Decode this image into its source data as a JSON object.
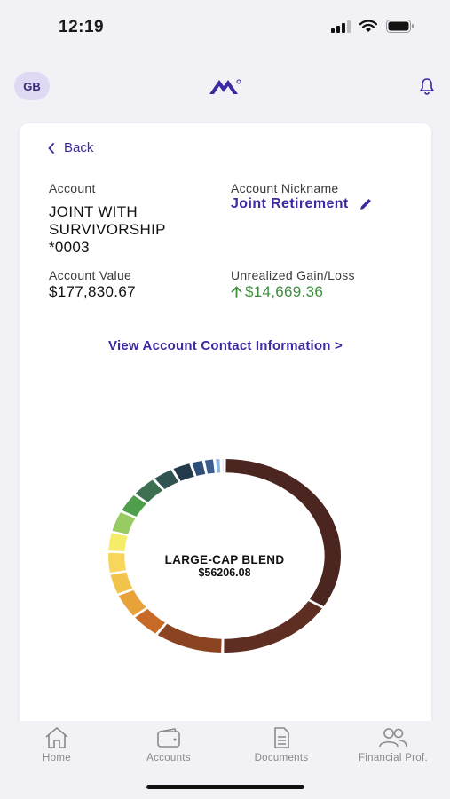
{
  "status": {
    "time": "12:19"
  },
  "header": {
    "avatar_initials": "GB",
    "logo_icon": "mountain-logo",
    "bell_icon": "bell-icon"
  },
  "card": {
    "back_label": "Back",
    "account_label": "Account",
    "account_name_lines": [
      "JOINT WITH",
      "SURVIVORSHIP",
      "*0003"
    ],
    "nickname_label": "Account Nickname",
    "nickname_value": "Joint Retirement",
    "value_label": "Account Value",
    "value_amount": "$177,830.67",
    "gain_label": "Unrealized Gain/Loss",
    "gain_amount": "$14,669.36",
    "view_contact": "View Account Contact Information >",
    "accent_color": "#3b2aa0",
    "gain_color": "#3e8e3e"
  },
  "chart_data": {
    "type": "pie",
    "style": "donut",
    "selected": {
      "label": "LARGE-CAP BLEND",
      "value": "$56206.08"
    },
    "values": [
      56206.08,
      27000,
      16000,
      7000,
      7000,
      6000,
      6000,
      5500,
      6000,
      5500,
      6000,
      5000,
      4500,
      3000,
      2500,
      1500,
      800
    ],
    "colors": [
      "#4b2620",
      "#5e2e22",
      "#8b4421",
      "#c76a28",
      "#e9a13a",
      "#f3c44c",
      "#f7d65b",
      "#f5ec69",
      "#98cc62",
      "#4e9e4c",
      "#3c7050",
      "#2f5452",
      "#233a4a",
      "#2e4d78",
      "#3c5e8f",
      "#8fb6e0",
      "#c9dcf0"
    ]
  },
  "tabs": [
    {
      "label": "Home",
      "icon": "home-icon"
    },
    {
      "label": "Accounts",
      "icon": "wallet-icon"
    },
    {
      "label": "Documents",
      "icon": "document-icon"
    },
    {
      "label": "Financial Prof.",
      "icon": "people-icon"
    }
  ]
}
